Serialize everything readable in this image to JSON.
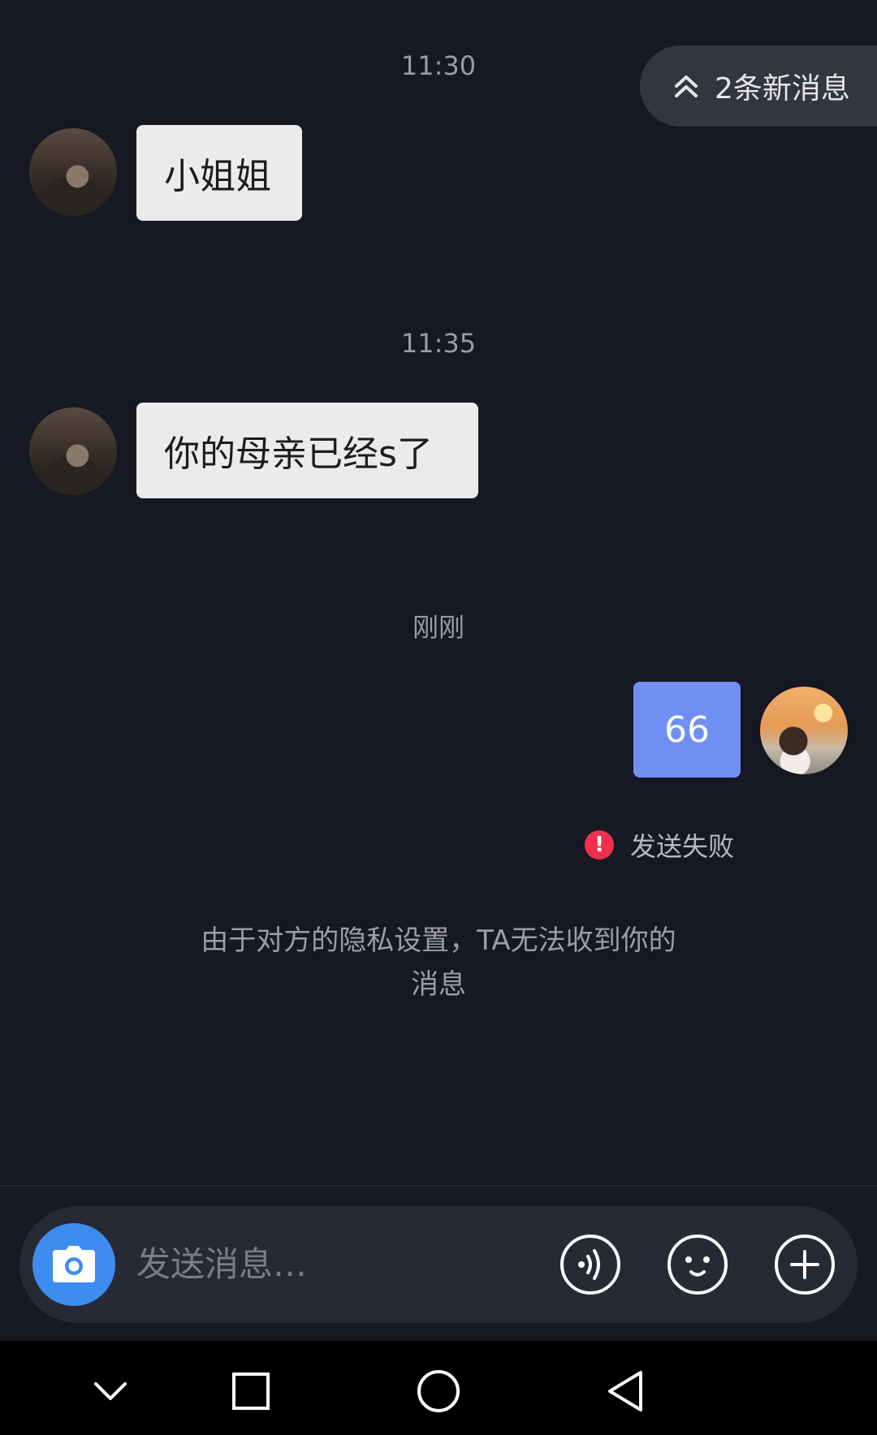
{
  "new_messages": {
    "label": "2条新消息"
  },
  "messages": [
    {
      "time": "11:30",
      "text": "小姐姐"
    },
    {
      "time": "11:35",
      "text": "你的母亲已经s了"
    },
    {
      "time": "刚刚",
      "text": "66"
    }
  ],
  "send_status": {
    "text": "发送失败",
    "icon": "!"
  },
  "privacy_notice": {
    "line1": "由于对方的隐私设置，TA无法收到你的",
    "line2": "消息"
  },
  "composer": {
    "placeholder": "发送消息…"
  },
  "icons": {
    "camera": "camera-icon",
    "voice": "voice-icon",
    "emoji": "emoji-icon",
    "plus": "plus-icon",
    "chevrons_up": "chevrons-up-icon",
    "nav_back": "triangle-back-icon",
    "nav_home": "circle-home-icon",
    "nav_recents": "square-recents-icon",
    "nav_hide": "chevron-down-icon"
  },
  "colors": {
    "background": "#161823",
    "incoming_bubble": "#ebebeb",
    "outgoing_bubble": "#6f8ff5",
    "camera_button": "#3d8cf0",
    "error": "#f0304d"
  }
}
